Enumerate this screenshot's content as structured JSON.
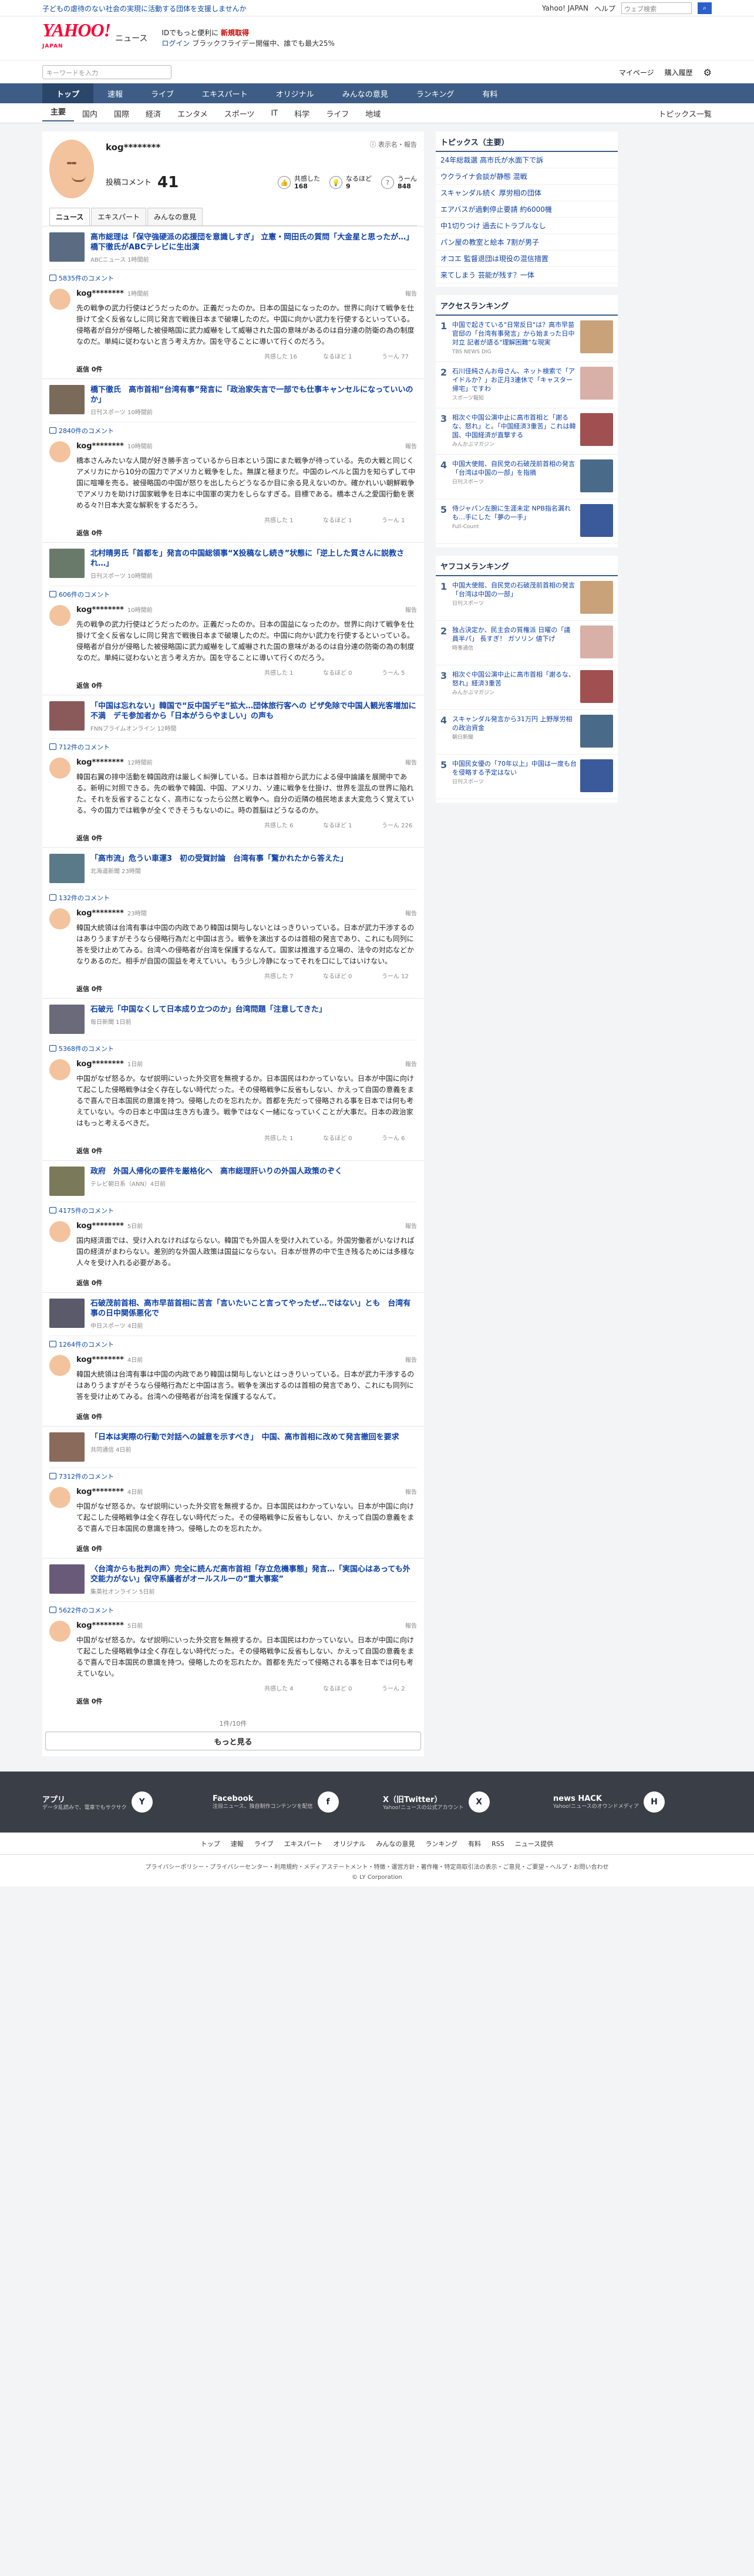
{
  "strip": {
    "notice": "子どもの虐待のない社会の実現に活動する団体を支援しませんか",
    "links": [
      "Yahoo! JAPAN",
      "ヘルプ"
    ],
    "search_placeholder": "ウェブ検索",
    "search_btn": "検索"
  },
  "header": {
    "logo": "YAHOO!",
    "logo_sub": "JAPAN",
    "section": "ニュース",
    "promo1_a": "IDでもっと便利に",
    "promo1_b": "新規取得",
    "promo2_a": "ログイン",
    "promo2_b": "ブラックフライデー開催中、誰でも最大25%"
  },
  "sbar": {
    "placeholder": "キーワードを入力",
    "mypage": "マイページ",
    "settings": "購入履歴"
  },
  "nav1": [
    "トップ",
    "速報",
    "ライブ",
    "エキスパート",
    "オリジナル",
    "みんなの意見",
    "ランキング",
    "有料"
  ],
  "nav2": [
    "主要",
    "国内",
    "国際",
    "経済",
    "エンタメ",
    "スポーツ",
    "IT",
    "科学",
    "ライフ",
    "地域"
  ],
  "nav2_more": "トピックス一覧",
  "profile": {
    "name": "kog********",
    "opts": "ⓘ 表示名・",
    "report": "報告",
    "comments_label": "投稿コメント",
    "comments_count": "41",
    "stats": [
      {
        "label": "共感した",
        "val": "168"
      },
      {
        "label": "なるほど",
        "val": "9"
      },
      {
        "label": "うーん",
        "val": "848"
      }
    ],
    "tabs": [
      "ニュース",
      "エキスパート",
      "みんなの意見"
    ]
  },
  "entries": [
    {
      "title": "高市総理は「保守強硬派の応援団を意識しすぎ」 立憲・岡田氏の質問「大金星と思ったが…」 橋下徹氏がABCテレビに生出演",
      "src": "ABCニュース 1時間前",
      "count": "5835件のコメント",
      "user": "kog********",
      "time": "1時間前",
      "text": "先の戦争の武力行使はどうだったのか。正義だったのか。日本の国益になったのか。世界に向けて戦争を仕掛けて全く反省なしに同じ発言で戦後日本まで破壊したのだ。中国に向かい武力を行使するといっている。侵略者が自分が侵略した被侵略国に武力威嚇をして威嚇された国の意味があるのは自分達の防衛の為の制度なのだ。単純に従わないと言う考え方か。国を守ることに導いて行くのだろう。",
      "reply": "返信 0件",
      "r": [
        "共感した 16",
        "なるほど 1",
        "うーん 77"
      ]
    },
    {
      "title": "橋下徹氏　高市首相“台湾有事”発言に「政治家失言で一部でも仕事キャンセルになっていいのか」",
      "src": "日刊スポーツ 10時間前",
      "count": "2840件のコメント",
      "user": "kog********",
      "time": "10時間前",
      "text": "橋本さんみたいな人間が好き勝手言っているから日本という国にまた戦争が待っている。先の大戦と同じくアメリカにから10分の国力でアメリカと戦争をした。無謀と極まりだ。中国のレベルと国力を知らずして中国に喧嘩を売る。被侵略国の中国が怒りを出したらどうなるか目に余る見えないのか。確かれいい朝鮮戦争でアメリカを助けけ国家戦争を日本に中国軍の実力をしらなすぎる。目標である。橋本さん之愛国行動を褒める々?!日本大変な解釈をするだろう。",
      "reply": "返信 0件",
      "r": [
        "共感した 1",
        "なるほど 1",
        "うーん 1"
      ]
    },
    {
      "title": "北村晴男氏「首都を」発言の中国総領事“X投稿なし続き”状態に「逆上した質さんに説教され…」",
      "src": "日刊スポーツ 10時間前",
      "count": "606件のコメント",
      "user": "kog********",
      "time": "10時間前",
      "text": "先の戦争の武力行使はどうだったのか。正義だったのか。日本の国益になったのか。世界に向けて戦争を仕掛けて全く反省なしに同じ発言で戦後日本まで破壊したのだ。中国に向かい武力を行使するといっている。侵略者が自分が侵略した被侵略国に武力威嚇をして威嚇された国の意味があるのは自分達の防衛の為の制度なのだ。単純に従わないと言う考え方か。国を守ることに導いて行くのだろう。",
      "reply": "返信 0件",
      "r": [
        "共感した 1",
        "なるほど 0",
        "うーん 5"
      ]
    },
    {
      "title": "「中国は忘れない」韓国で“反中国デモ”拡大…団体旅行客への ビザ免除で中国人観光客増加に不満　デモ参加者から「日本がうらやましい」の声も",
      "src": "FNNプライムオンライン 12時間",
      "count": "712件のコメント",
      "user": "kog********",
      "time": "12時間前",
      "text": "韓国右翼の排中活動を韓国政府は厳しく糾弾している。日本は首相から武力による侵中論議を展開中である。新明に対照できる。先の戦争で韓国、中国、アメリカ、ソ連に戦争を仕掛け、世界を混乱の世界に陥れた。それを反省することなく、高市になったら公然と戦争へ。自分の近隣の植民地まま大変危うく覚えている。今の国力では戦争が全くできそうもないのに。時の首脳はどうなるのか。",
      "reply": "返信 0件",
      "r": [
        "共感した 6",
        "なるほど 1",
        "うーん 226"
      ]
    },
    {
      "title": "「高市流」危うい車運3　初の受賀討論　台湾有事「驚かれたから答えた」",
      "src": "北海道新聞 23時間",
      "count": "132件のコメント",
      "user": "kog********",
      "time": "23時間",
      "text": "韓国大統領は台湾有事は中国の内政であり韓国は関与しないとはっきりいっている。日本が武力干渉するのはありうますがそうなら侵略行為だと中国は言う。戦争を演出するのは首相の発言であり、これにも同列に答を受け止めてみる。台湾への侵略者が台湾を保護するなんて。国家は推進する立場の、法令の対応などかなりあるのだ。相手が自国の国益を考えていい。もう少し冷静になってそれを口にしてはいけない。",
      "reply": "返信 0件",
      "r": [
        "共感した 7",
        "なるほど 0",
        "うーん 12"
      ]
    },
    {
      "title": "石破元「中国なくして日本成り立つのか」台湾問題「注意してきた」",
      "src": "毎日新聞 1日前",
      "count": "5368件のコメント",
      "user": "kog********",
      "time": "1日前",
      "text": "中国がなぜ怒るか。なぜ説明にいった外交官を無視するか。日本国民はわかっていない。日本が中国に向けて起こした侵略戦争は全く存在しない時代だった。その侵略戦争に反省もしない、かえって自国の意義をまるで喜んで日本国民の意識を持つ。侵略したのを忘れたか。首都を先だって侵略される事を日本では何も考えていない。今の日本と中国は生き方も違う。戦争ではなく一緒になっていくことが大事だ。日本の政治家はもっと考えるべきだ。",
      "reply": "返信 0件",
      "r": [
        "共感した 1",
        "なるほど 0",
        "うーん 6"
      ]
    },
    {
      "title": "政府　外国人帰化の要件を厳格化へ　高市総理肝いりの外国人政策のぞく",
      "src": "テレビ朝日系（ANN）4日前",
      "count": "4175件のコメント",
      "user": "kog********",
      "time": "5日前",
      "text": "国内経済面では、受け入れなければならない。韓国でも外国人を受け入れている。外国労働者がいなければ国の経済がまわらない。差別的な外国人政策は国益にならない。日本が世界の中で生き残るためには多様な人々を受け入れる必要がある。",
      "reply": "返信 0件",
      "r": [
        "",
        "",
        ""
      ]
    },
    {
      "title": "石破茂前首相、高市早苗首相に苦言「言いたいこと言ってやったぜ…ではない」とも　台湾有事の日中関係悪化で",
      "src": "中日スポーツ 4日前",
      "count": "1264件のコメント",
      "user": "kog********",
      "time": "4日前",
      "text": "韓国大統領は台湾有事は中国の内政であり韓国は関与しないとはっきりいっている。日本が武力干渉するのはありうますがそうなら侵略行為だと中国は言う。戦争を演出するのは首相の発言であり、これにも同列に答を受け止めてみる。台湾への侵略者が台湾を保護するなんて。",
      "reply": "返信 0件",
      "r": [
        "",
        "",
        ""
      ]
    },
    {
      "title": "「日本は実際の行動で対話への誠意を示すべき」　中国、高市首相に改めて発言撤回を要求",
      "src": "共同通信 4日前",
      "count": "7312件のコメント",
      "user": "kog********",
      "time": "4日前",
      "text": "中国がなぜ怒るか。なぜ説明にいった外交官を無視するか。日本国民はわかっていない。日本が中国に向けて起こした侵略戦争は全く存在しない時代だった。その侵略戦争に反省もしない、かえって自国の意義をまるで喜んで日本国民の意識を持つ。侵略したのを忘れたか。",
      "reply": "返信 0件",
      "r": [
        "",
        "",
        ""
      ]
    },
    {
      "title": "〈台湾からも批判の声〉完全に読んだ高市首相「存立危機事態」発言…「実国心はあっても外交能力がない」保守系議者がオールスルーの“重大事案”",
      "src": "集英社オンライン 5日前",
      "count": "5622件のコメント",
      "user": "kog********",
      "time": "5日前",
      "text": "中国がなぜ怒るか。なぜ説明にいった外交官を無視するか。日本国民はわかっていない。日本が中国に向けて起こした侵略戦争は全く存在しない時代だった。その侵略戦争に反省もしない、かえって自国の意義をまるで喜んで日本国民の意識を持つ。侵略したのを忘れたか。首都を先だって侵略される事を日本では何も考えていない。",
      "reply": "返信 0件",
      "r": [
        "共感した 4",
        "なるほど 0",
        "うーん 2"
      ]
    }
  ],
  "pager": "1件/10件",
  "more": "もっと見る",
  "side": {
    "topics_title": "トピックス（主要）",
    "topics": [
      "24年総裁選 高市氏が水面下で訴",
      "ウクライナ会談が静態 混戦",
      "スキャンダル続く 厚労相の団体",
      "エアバスが過剰停止要請 約6000機",
      "中1切りつけ 過去にトラブルなし",
      "パン屋の教室と絵本 7割が男子",
      "オコエ 監督退団は現役の混信措置",
      "来てしまう 芸能が残す？一体"
    ],
    "rank_title": "アクセスランキング",
    "ranks": [
      {
        "t": "中国で起きている\"日常反日\"は？高市早苗官邸の「台湾有事発言」から始まった日中対立 記者が語る\"理解困難\"な現実",
        "s": "TBS NEWS DIG"
      },
      {
        "t": "石川佳純さんお母さん、ネット検索で「アイドルか？」お正月3連休で「キャスター帰宅」ですわ",
        "s": "スポーツ報知"
      },
      {
        "t": "相次ぐ中国公演中止に高市首相と「謝るな、怒れ」と。「中国経済3重苦」これは韓国、中国経済が直撃する",
        "s": "みんかぶマガジン"
      },
      {
        "t": "中国大使館、自民党の石破茂前首相の発言「台湾は中国の一部」を指摘",
        "s": "日刊スポーツ"
      },
      {
        "t": "侍ジャパン左腕に生涯未定 NPB指名漏れも…手にした「夢の一手」",
        "s": "Full-Count"
      }
    ],
    "yrank_title": "ヤフコメランキング",
    "yranks": [
      {
        "t": "中国大使館、自民党の石破茂前首相の発言「台湾は中国の一部」",
        "s": "日刊スポーツ"
      },
      {
        "t": "独占決定か、民主会の質権派 日曜の「議員半パ」 長すぎ！ ガソリン 値下げ",
        "s": "時事通信"
      },
      {
        "t": "相次ぐ中国公演中止に高市首相「謝るな、怒れ」経済3重苦",
        "s": "みんかぶマガジン"
      },
      {
        "t": "スキャンダル発言から31万円 上野厚労相の政治資金",
        "s": "朝日新聞"
      },
      {
        "t": "中国民女優の「70年以上」中国は一度も台を侵略する予定はない",
        "s": "日刊スポーツ"
      }
    ]
  },
  "footer": {
    "cells": [
      {
        "t": "アプリ",
        "s": "データ乱読みで、電車でもサクサク",
        "i": "Y"
      },
      {
        "t": "Facebook",
        "s": "注目ニュース、独自制作コンテンツを配信",
        "i": "f"
      },
      {
        "t": "X（旧Twitter）",
        "s": "Yahoo!ニュースの公式アカウント",
        "i": "X"
      },
      {
        "t": "news HACK",
        "s": "Yahoo!ニュースのオウンドメディア",
        "i": "H"
      }
    ],
    "links": [
      "トップ",
      "速報",
      "ライブ",
      "エキスパート",
      "オリジナル",
      "みんなの意見",
      "ランキング",
      "有料",
      "RSS",
      "ニュース提供"
    ],
    "legal": "プライバシーポリシー・プライバシーセンター・利用規約・メディアステートメント・特徴・運営方針・著作権・特定商取引法の表示・ご意見・ご要望・ヘルプ・お問い合わせ",
    "copy": "© LY Corporation"
  }
}
